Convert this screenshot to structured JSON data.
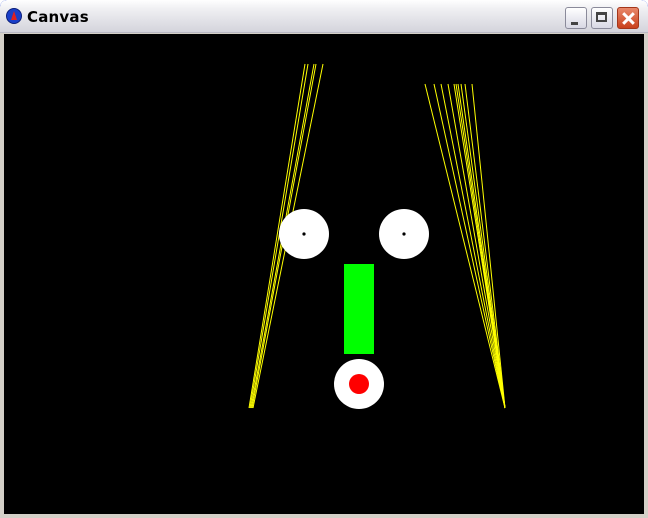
{
  "window": {
    "title": "Canvas",
    "icon": "app-icon",
    "controls": [
      "minimize-icon",
      "maximize-icon",
      "close-icon"
    ]
  },
  "colors": {
    "background": "#000000",
    "lines": "#ffff00",
    "eyes": "#ffffff",
    "pupils": "#000000",
    "nose": "#00ff00",
    "mouth_outer": "#ffffff",
    "mouth_inner": "#ff0000"
  }
}
